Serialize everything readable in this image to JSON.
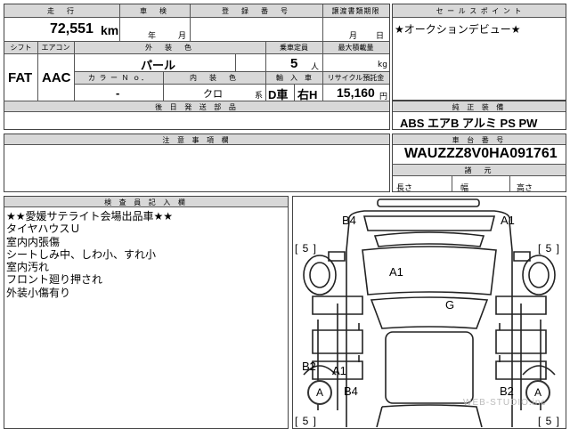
{
  "row1": {
    "mileage_label": "走　行",
    "mileage_value": "72,551",
    "mileage_unit": "km",
    "inspection_label": "車　検",
    "year_unit": "年",
    "month_unit": "月",
    "reg_label": "登　録　番　号",
    "transfer_label": "譲渡書類期限",
    "transfer_month": "月",
    "transfer_day": "日"
  },
  "sales": {
    "label": "セ ー ル ス ポ イ ン ト",
    "text": "★オークションデビュー★"
  },
  "row2": {
    "shift_label": "シフト",
    "shift_value": "FAT",
    "ac_label": "エアコン",
    "ac_value": "AAC",
    "exterior_label": "外　装　色",
    "exterior_value": "パール",
    "capacity_label": "乗車定員",
    "capacity_value": "5",
    "capacity_unit": "人",
    "load_label": "最大積載量",
    "load_unit": "kg",
    "color_no_label": "カ ラ ー Ｎ ｏ．",
    "color_no_value": "-",
    "interior_label": "内　装　色",
    "interior_value": "クロ",
    "interior_suffix": "系",
    "import_label": "輸　入　車",
    "import_value_1": "D車",
    "import_value_2": "右H",
    "recycle_label": "リサイクル預託金",
    "recycle_value": "15,160",
    "recycle_unit": "円"
  },
  "later_parts": {
    "label": "後 日 発 送 部 品"
  },
  "equipment": {
    "label": "純 正 装 備",
    "items": "ABS エアB アルミ PS PW"
  },
  "caution": {
    "label": "注 意 事 項 欄"
  },
  "chassis": {
    "label": "車 台 番 号",
    "value": "WAUZZZ8V0HA091761",
    "dims_label": "諸　元",
    "length": "長さ",
    "width": "幅",
    "height": "高さ"
  },
  "inspector": {
    "label": "検 査 員 記 入 欄",
    "notes": [
      "★★愛媛サテライト会場出品車★★",
      "タイヤハウスＵ",
      "室内内張傷",
      "シートしみ中、しわ小、すれ小",
      "室内汚れ",
      "フロント廻り押され",
      "外装小傷有り"
    ]
  },
  "diagram": {
    "marks": {
      "front_left_corner": "B4",
      "front_right_corner": "A1",
      "hood": "A1",
      "roof": "G",
      "rear_door_left": "B2",
      "rear_left": "A1",
      "rear_bottom_left": "B4",
      "rear_right": "B2"
    },
    "tire_front_left": "[ 5 ]",
    "tire_front_right": "[ 5 ]",
    "tire_rear_left": "[ 5 ]",
    "tire_rear_right": "[ 5 ]",
    "wheel_left": "A",
    "wheel_right": "A",
    "watermark": "WEB-STUDIO.inc"
  }
}
